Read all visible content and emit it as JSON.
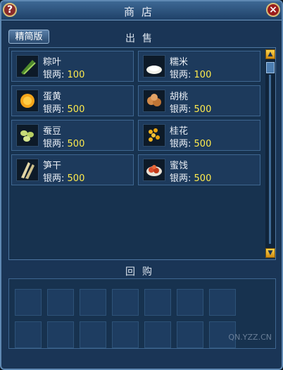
{
  "window": {
    "title": "商店"
  },
  "buttons": {
    "help": "?",
    "close": "×",
    "mode": "精简版"
  },
  "sell": {
    "label": "出售",
    "price_label": "银两:",
    "items": [
      {
        "name": "粽叶",
        "price": "100",
        "icon": "zongzi-leaf-icon"
      },
      {
        "name": "糯米",
        "price": "100",
        "icon": "glutinous-rice-icon"
      },
      {
        "name": "蛋黄",
        "price": "500",
        "icon": "egg-yolk-icon"
      },
      {
        "name": "胡桃",
        "price": "500",
        "icon": "walnut-icon"
      },
      {
        "name": "蚕豆",
        "price": "500",
        "icon": "broad-bean-icon"
      },
      {
        "name": "桂花",
        "price": "500",
        "icon": "osmanthus-icon"
      },
      {
        "name": "笋干",
        "price": "500",
        "icon": "dried-bamboo-shoot-icon"
      },
      {
        "name": "蜜饯",
        "price": "500",
        "icon": "candied-fruit-icon"
      }
    ]
  },
  "buyback": {
    "label": "回购",
    "slot_count": 14
  },
  "watermark": {
    "text": "QN.YZZ.CN"
  },
  "colors": {
    "price": "#ffeb4d",
    "panel": "#1a3556",
    "border": "#5f89b3"
  }
}
